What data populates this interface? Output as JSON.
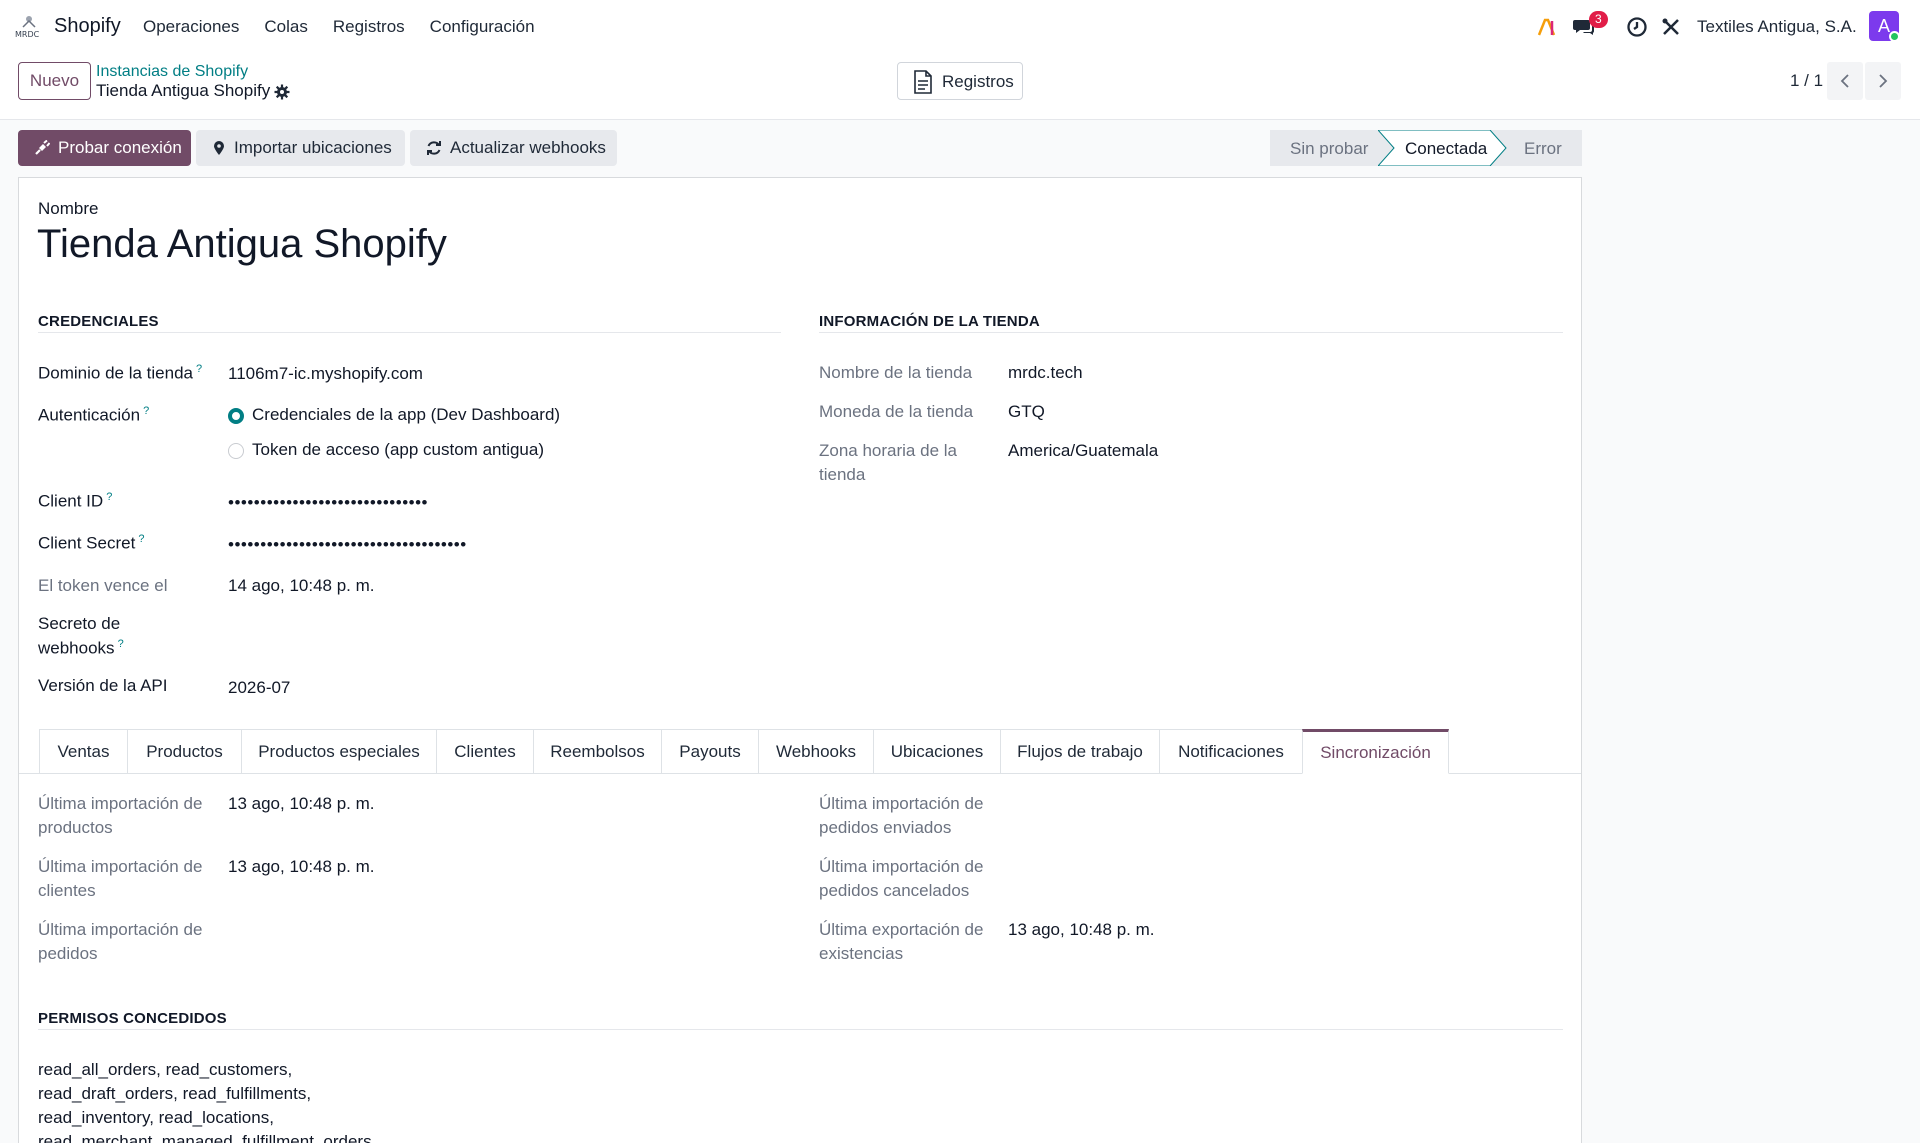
{
  "nav": {
    "app_name": "Shopify",
    "menu": [
      "Operaciones",
      "Colas",
      "Registros",
      "Configuración"
    ],
    "chat_badge": "3",
    "company": "Textiles Antigua, S.A.",
    "avatar_letter": "A"
  },
  "control": {
    "new_label": "Nuevo",
    "breadcrumb_parent": "Instancias de Shopify",
    "breadcrumb_current": "Tienda Antigua Shopify",
    "logs_label": "Registros",
    "pager": "1 / 1"
  },
  "actions": {
    "test_connection": "Probar conexión",
    "import_locations": "Importar ubicaciones",
    "update_webhooks": "Actualizar webhooks"
  },
  "status_bar": {
    "stages": [
      "Sin probar",
      "Conectada",
      "Error"
    ],
    "current": "Conectada"
  },
  "record": {
    "name_label": "Nombre",
    "name": "Tienda Antigua Shopify"
  },
  "credentials": {
    "title": "CREDENCIALES",
    "domain_label": "Dominio de la tienda",
    "domain": "1106m7-ic.myshopify.com",
    "auth_label": "Autenticación",
    "auth_options": [
      "Credenciales de la app (Dev Dashboard)",
      "Token de acceso (app custom antigua)"
    ],
    "auth_selected": "Credenciales de la app (Dev Dashboard)",
    "client_id_label": "Client ID",
    "client_id": "•••••••••••••••••••••••••••••••",
    "client_secret_label": "Client Secret",
    "client_secret": "•••••••••••••••••••••••••••••••••••••",
    "token_expiry_label": "El token vence el",
    "token_expiry": "14 ago, 10:48 p. m.",
    "webhook_secret_label_1": "Secreto de",
    "webhook_secret_label_2": "webhooks",
    "api_version_label": "Versión de la API",
    "api_version": "2026-07"
  },
  "store_info": {
    "title": "INFORMACIÓN DE LA TIENDA",
    "store_name_label": "Nombre de la tienda",
    "store_name": "mrdc.tech",
    "currency_label": "Moneda de la tienda",
    "currency": "GTQ",
    "timezone_label_1": "Zona horaria de la",
    "timezone_label_2": "tienda",
    "timezone": "America/Guatemala"
  },
  "tabs": [
    "Ventas",
    "Productos",
    "Productos especiales",
    "Clientes",
    "Reembolsos",
    "Payouts",
    "Webhooks",
    "Ubicaciones",
    "Flujos de trabajo",
    "Notificaciones",
    "Sincronización"
  ],
  "active_tab": "Sincronización",
  "sync": {
    "products_label_1": "Última importación de",
    "products_label_2": "productos",
    "products_value": "13 ago, 10:48 p. m.",
    "customers_label_1": "Última importación de",
    "customers_label_2": "clientes",
    "customers_value": "13 ago, 10:48 p. m.",
    "orders_label_1": "Última importación de",
    "orders_label_2": "pedidos",
    "shipped_label_1": "Última importación de",
    "shipped_label_2": "pedidos enviados",
    "cancelled_label_1": "Última importación de",
    "cancelled_label_2": "pedidos cancelados",
    "stock_label_1": "Última exportación de",
    "stock_label_2": "existencias",
    "stock_value": "13 ago, 10:48 p. m."
  },
  "permissions": {
    "title": "PERMISOS CONCEDIDOS",
    "lines": [
      "read_all_orders, read_customers,",
      "read_draft_orders, read_fulfillments,",
      "read_inventory, read_locations,",
      "read_merchant_managed_fulfillment_orders,"
    ]
  },
  "colors": {
    "brand": "#714b67",
    "accent": "#017e84"
  }
}
